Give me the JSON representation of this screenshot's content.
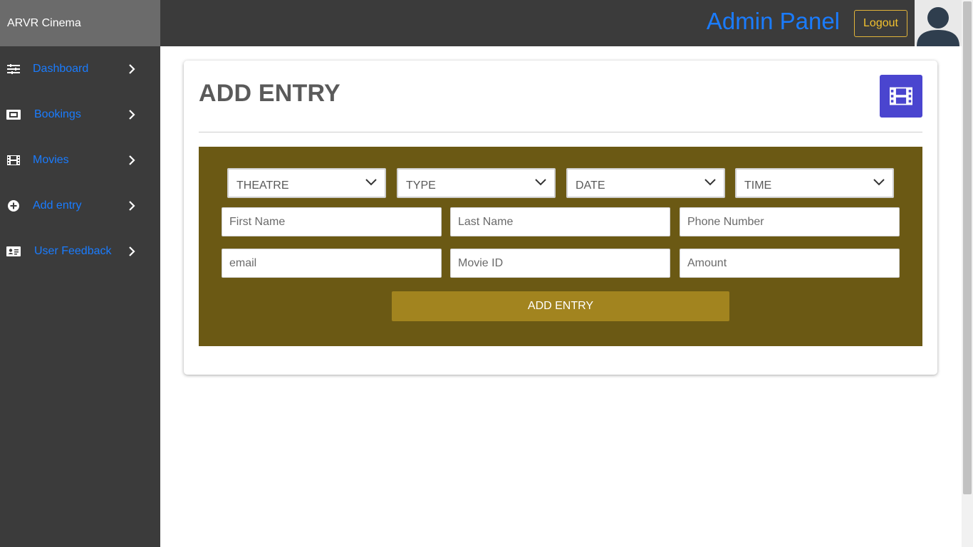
{
  "sidebar": {
    "brand": "ARVR Cinema",
    "items": [
      {
        "label": "Dashboard",
        "icon": "sliders-icon"
      },
      {
        "label": "Bookings",
        "icon": "ticket-icon"
      },
      {
        "label": "Movies",
        "icon": "film-icon"
      },
      {
        "label": "Add entry",
        "icon": "plus-circle-icon"
      },
      {
        "label": "User Feedback",
        "icon": "id-card-icon"
      }
    ]
  },
  "header": {
    "title": "Admin Panel",
    "logout_label": "Logout",
    "avatar_icon": "user-avatar-icon"
  },
  "card": {
    "title": "ADD ENTRY",
    "badge_icon": "film-icon"
  },
  "form": {
    "selects": [
      "THEATRE",
      "TYPE",
      "DATE",
      "TIME"
    ],
    "fields": {
      "first_name": {
        "placeholder": "First Name",
        "value": ""
      },
      "last_name": {
        "placeholder": "Last Name",
        "value": ""
      },
      "phone": {
        "placeholder": "Phone Number",
        "value": ""
      },
      "email": {
        "placeholder": "email",
        "value": ""
      },
      "movie_id": {
        "placeholder": "Movie ID",
        "value": ""
      },
      "amount": {
        "placeholder": "Amount",
        "value": ""
      }
    },
    "submit_label": "ADD ENTRY"
  },
  "colors": {
    "sidebar_bg": "#3b3b3b",
    "brand_bg": "#6b6b6b",
    "link": "#1a7cff",
    "logout": "#f2c12e",
    "badge": "#4a45cf",
    "form_panel": "#6b5914",
    "submit_button": "#a2841f"
  }
}
